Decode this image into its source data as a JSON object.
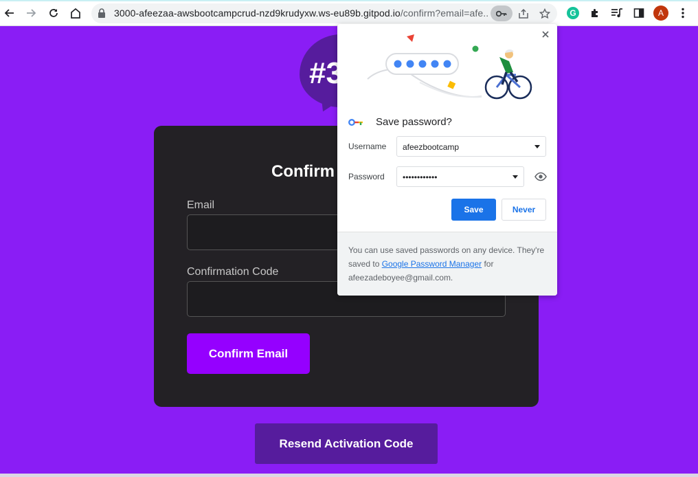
{
  "browser": {
    "url_main": "3000-afeezaa-awsbootcampcrud-nzd9krudyxw.ws-eu89b.gitpod.io",
    "url_rest": "/confirm?email=afe...",
    "avatar_letter": "A",
    "grammarly_letter": "G"
  },
  "page": {
    "logo_text": "#3",
    "card_title": "Confirm",
    "email_label": "Email",
    "code_label": "Confirmation Code",
    "confirm_button": "Confirm Email",
    "resend_button": "Resend Activation Code"
  },
  "password_bubble": {
    "title": "Save password?",
    "username_label": "Username",
    "username_value": "afeezbootcamp",
    "password_label": "Password",
    "password_value": "••••••••••••",
    "save_button": "Save",
    "never_button": "Never",
    "footer_text_1": "You can use saved passwords on any device. They're saved to ",
    "footer_link": "Google Password Manager",
    "footer_text_2": " for afeezadeboyee@gmail.com."
  },
  "colors": {
    "page_background": "#8a1df5",
    "card_background": "#232125",
    "confirm_button": "#9500ff",
    "resend_button": "#561c9d",
    "save_button": "#1a73e8"
  }
}
